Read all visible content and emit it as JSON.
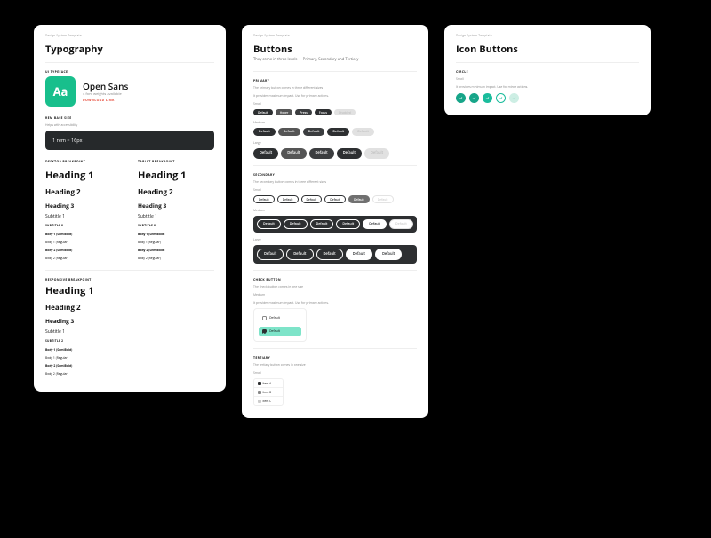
{
  "crumb": "Design System Template",
  "typo": {
    "title": "Typography",
    "typeface_section": "UI TYPEFACE",
    "tile_letters": "Aa",
    "typeface_name": "Open Sans",
    "typeface_sub": "4 font weights available",
    "download": "DOWNLOAD LINK",
    "rem_section": "REM BASE SIZE",
    "rem_desc": "Helps with accessibility",
    "rem_value": "1 rem  = 16px",
    "desktop_bp": "DESKTOP BREAKPOINT",
    "tablet_bp": "TABLET BREAKPOINT",
    "responsive_bp": "RESPONSIVE BREAKPOINT",
    "scale": {
      "h1": "Heading 1",
      "h2": "Heading 2",
      "h3": "Heading 3",
      "s1": "Subtitle 1",
      "s2": "SUBTITLE 2",
      "b1sb": "Body 1 (SemiBold)",
      "b1r": "Body 1 (Regular)",
      "b2sb": "Body 2 (SemiBold)",
      "b2r": "Body 2 (Regular)"
    }
  },
  "buttons": {
    "title": "Buttons",
    "subtitle": "They come in three levels — Primary, Secondary and Tertiary",
    "primary": "PRIMARY",
    "primary_desc": "The primary button comes in three different sizes",
    "primary_note": "It provides maximum impact. Use for primary actions.",
    "secondary": "SECONDARY",
    "secondary_desc": "The secondary button comes in three different sizes",
    "check": "CHECK BUTTON",
    "check_desc": "The check button comes in one size",
    "tertiary": "TERTIARY",
    "tertiary_desc": "The tertiary button comes in one size",
    "sz_small": "Small",
    "sz_medium": "Medium",
    "sz_large": "Large",
    "states": [
      "Default",
      "Hover",
      "Press",
      "Focus",
      "Disabled"
    ],
    "label": "Default",
    "tert": [
      "Item A",
      "Item B",
      "Item C"
    ]
  },
  "iconbtns": {
    "title": "Icon Buttons",
    "circle": "CIRCLE",
    "circle_desc": "Small",
    "circle_note": "It provides minimum impact. Use for minor actions."
  },
  "colors": {
    "teal": "#18bf8c",
    "teal_light": "#7ee4c9",
    "dark": "#2d2f31"
  }
}
